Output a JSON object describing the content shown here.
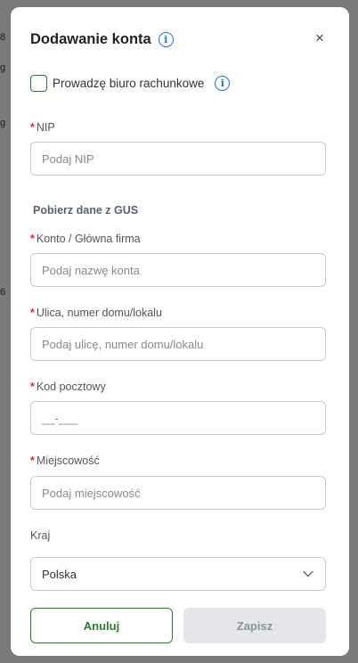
{
  "background_fragments": [
    "8",
    "g",
    "g",
    "6"
  ],
  "modal": {
    "title": "Dodawanie konta",
    "close_glyph": "×"
  },
  "checkbox": {
    "label": "Prowadzę biuro rachunkowe",
    "checked": false
  },
  "fields": {
    "nip": {
      "label": "NIP",
      "required": true,
      "placeholder": "Podaj NIP",
      "value": ""
    },
    "gus_link": "Pobierz dane z GUS",
    "account": {
      "label": "Konto / Główna firma",
      "required": true,
      "placeholder": "Podaj nazwę konta",
      "value": ""
    },
    "street": {
      "label": "Ulica, numer domu/lokalu",
      "required": true,
      "placeholder": "Podaj ulicę, numer domu/lokalu",
      "value": ""
    },
    "postal": {
      "label": "Kod pocztowy",
      "required": true,
      "placeholder": "__-___",
      "value": ""
    },
    "city": {
      "label": "Miejscowość",
      "required": true,
      "placeholder": "Podaj miejscowość",
      "value": ""
    },
    "country": {
      "label": "Kraj",
      "required": false,
      "value": "Polska"
    }
  },
  "required_marker": "*",
  "buttons": {
    "cancel": "Anuluj",
    "save": "Zapisz"
  },
  "colors": {
    "accent_green": "#2e7d32",
    "info_blue": "#1f74d6",
    "required_red": "#d32f2f",
    "disabled_bg": "#e4e6ea"
  },
  "icons": [
    "info-icon",
    "close-icon",
    "chevron-down-icon"
  ]
}
